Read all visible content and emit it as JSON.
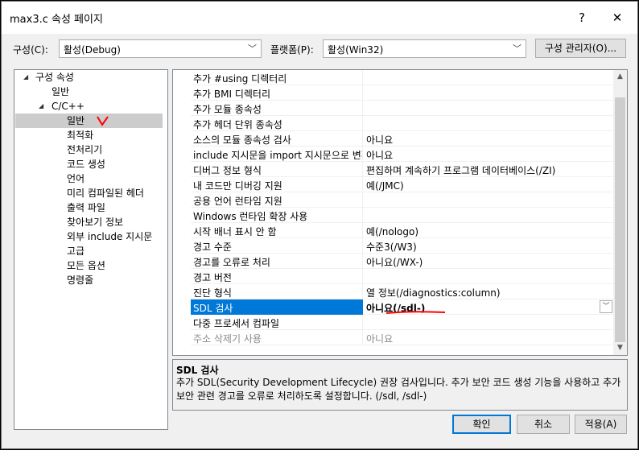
{
  "window": {
    "title": "max3.c 속성 페이지",
    "help_glyph": "?",
    "close_glyph": "✕"
  },
  "toolbar": {
    "config_label": "구성(C):",
    "config_value": "활성(Debug)",
    "platform_label": "플랫폼(P):",
    "platform_value": "활성(Win32)",
    "manager_label": "구성 관리자(O)..."
  },
  "tree": {
    "root": "구성 속성",
    "general": "일반",
    "cpp": "C/C++",
    "children": [
      {
        "label": "일반",
        "selected": true
      },
      {
        "label": "최적화"
      },
      {
        "label": "전처리기"
      },
      {
        "label": "코드 생성"
      },
      {
        "label": "언어"
      },
      {
        "label": "미리 컴파일된 헤더"
      },
      {
        "label": "출력 파일"
      },
      {
        "label": "찾아보기 정보"
      },
      {
        "label": "외부 include 지시문"
      },
      {
        "label": "고급"
      },
      {
        "label": "모든 옵션"
      },
      {
        "label": "명령줄"
      }
    ],
    "annotation": "V"
  },
  "properties": [
    {
      "name": "추가 #using 디렉터리",
      "value": ""
    },
    {
      "name": "추가 BMI 디렉터리",
      "value": ""
    },
    {
      "name": "추가 모듈 종속성",
      "value": ""
    },
    {
      "name": "추가 헤더 단위 종속성",
      "value": ""
    },
    {
      "name": "소스의 모듈 종속성 검사",
      "value": "아니요"
    },
    {
      "name": "include 지시문을 import 지시문으로 변환",
      "value": "아니요"
    },
    {
      "name": "디버그 정보 형식",
      "value": "편집하며 계속하기 프로그램 데이터베이스(/ZI)"
    },
    {
      "name": "내 코드만 디버깅 지원",
      "value": "예(/JMC)"
    },
    {
      "name": "공용 언어 런타임 지원",
      "value": ""
    },
    {
      "name": "Windows 런타임 확장 사용",
      "value": ""
    },
    {
      "name": "시작 배너 표시 안 함",
      "value": "예(/nologo)"
    },
    {
      "name": "경고 수준",
      "value": "수준3(/W3)"
    },
    {
      "name": "경고를 오류로 처리",
      "value": "아니요(/WX-)"
    },
    {
      "name": "경고 버전",
      "value": ""
    },
    {
      "name": "진단 형식",
      "value": "열 정보(/diagnostics:column)"
    },
    {
      "name": "SDL 검사",
      "value": "아니요(/sdl-)",
      "selected": true
    },
    {
      "name": "다중 프로세서 컴파일",
      "value": ""
    },
    {
      "name": "주소 삭제기 사용",
      "value": "아니요",
      "dim": true
    }
  ],
  "description": {
    "title": "SDL 검사",
    "text": "추가 SDL(Security Development Lifecycle) 권장 검사입니다. 추가 보안 코드 생성 기능을 사용하고 추가 보안 관련 경고를 오류로 처리하도록 설정합니다. (/sdl, /sdl-)"
  },
  "buttons": {
    "ok": "확인",
    "cancel": "취소",
    "apply": "적용(A)"
  },
  "colors": {
    "selection": "#0078d7",
    "annotation": "#ff0000"
  }
}
